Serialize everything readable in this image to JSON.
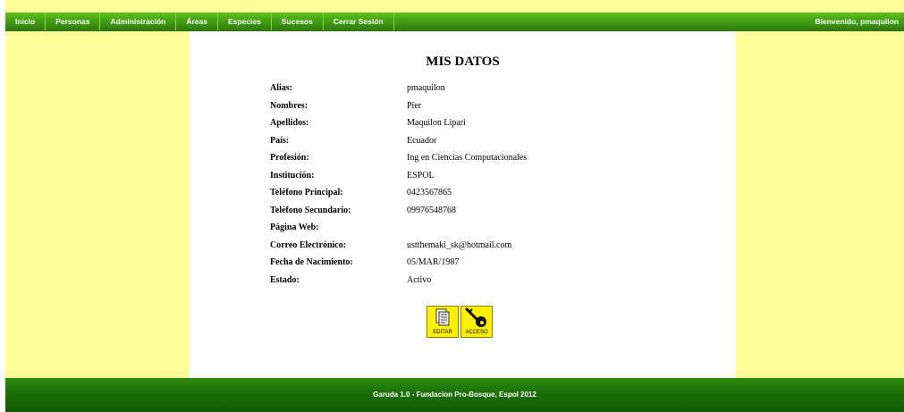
{
  "nav": {
    "items": [
      "Inicio",
      "Personas",
      "Administración",
      "Áreas",
      "Especies",
      "Sucesos",
      "Cerrar Sesión"
    ],
    "welcome": "Bienvenido, pmaquilon"
  },
  "page": {
    "title": "MIS DATOS"
  },
  "profile": [
    {
      "label": "Alias:",
      "value": "pmaquilon"
    },
    {
      "label": "Nombres:",
      "value": "Pier"
    },
    {
      "label": "Apellidos:",
      "value": "Maquilon Lipari"
    },
    {
      "label": "País:",
      "value": "Ecuador"
    },
    {
      "label": "Profesión:",
      "value": "Ing en Ciencias Computacionales"
    },
    {
      "label": "Institución:",
      "value": "ESPOL"
    },
    {
      "label": "Teléfono Principal:",
      "value": "0423567865"
    },
    {
      "label": "Teléfono Secundario:",
      "value": "09976548768"
    },
    {
      "label": "Página Web:",
      "value": ""
    },
    {
      "label": "Correo Electrónico:",
      "value": "ustthemaki_sk@hotmail.com"
    },
    {
      "label": "Fecha de Nacimiento:",
      "value": "05/MAR/1987"
    },
    {
      "label": "Estado:",
      "value": "Activo"
    }
  ],
  "actions": {
    "edit_label": "EDITAR",
    "access_label": "ACCESO"
  },
  "footer": {
    "text": "Garuda 1.0 - Fundacion Pro-Bosque, Espol 2012"
  },
  "colors": {
    "nav_green": "#3f9a14",
    "side_yellow": "#ffff99",
    "button_yellow": "#ffef00",
    "footer_green": "#1d6e08"
  },
  "icons": {
    "edit": "document-edit-icon",
    "access": "key-icon"
  }
}
